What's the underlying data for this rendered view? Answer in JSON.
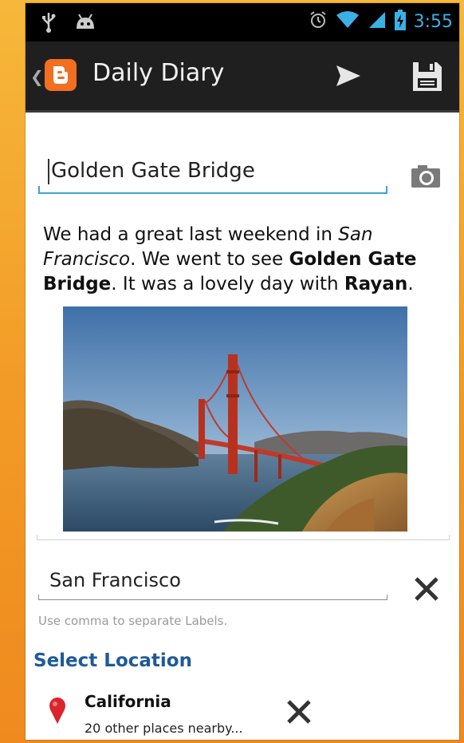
{
  "status_bar": {
    "left_icons": [
      "usb-icon",
      "android-debug-icon"
    ],
    "right_icons": [
      "alarm-clock-icon",
      "wifi-icon",
      "cell-signal-icon",
      "battery-charging-icon"
    ],
    "time": "3:55",
    "icon_color": "#3bb0e6"
  },
  "action_bar": {
    "app_title": "Daily Diary",
    "logo_icon": "blogger-logo-icon",
    "actions": [
      "send-icon",
      "save-icon"
    ],
    "accent": "#f26f21"
  },
  "post": {
    "title_value": "Golden Gate Bridge",
    "body": {
      "s1": "We had a great last weekend in ",
      "s2": "San Francisco",
      "s3": ". We went to see ",
      "s4": "Golden Gate Bridge",
      "s5": ". It was a lovely day with ",
      "s6": "Rayan",
      "s7": "."
    },
    "photo_icon": "camera-icon"
  },
  "labels": {
    "value": "San Francisco",
    "hint": "Use comma to separate Labels."
  },
  "location": {
    "heading": "Select Location",
    "name": "California",
    "subtitle": "20 other places nearby...",
    "heading_color": "#1d5a9a"
  }
}
